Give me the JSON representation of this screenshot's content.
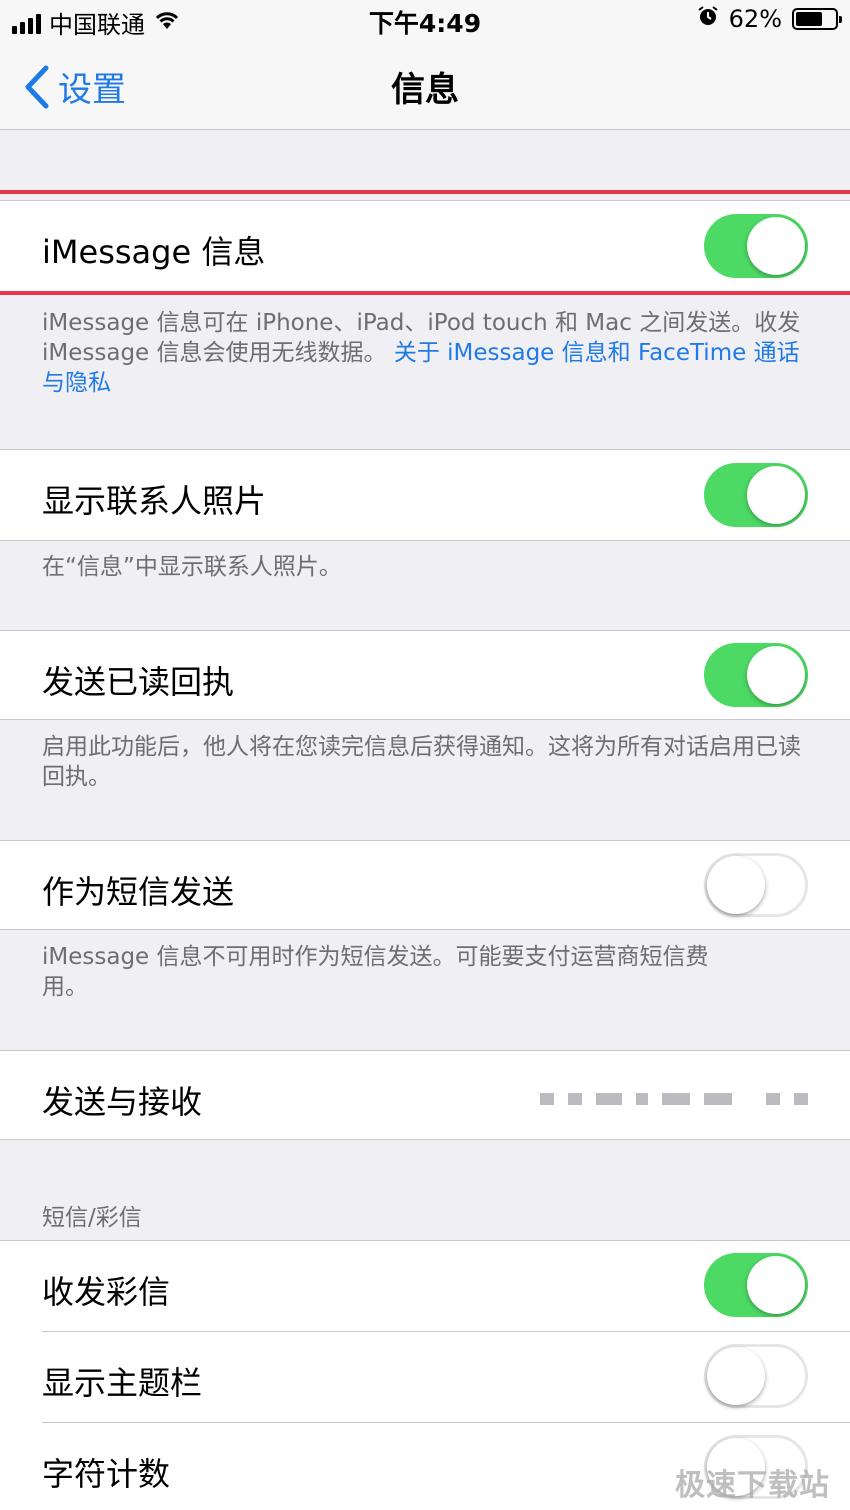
{
  "status_bar": {
    "carrier": "中国联通",
    "time": "下午4:49",
    "battery_percent": "62%",
    "battery_level": 0.62,
    "icons": [
      "signal-icon",
      "wifi-icon",
      "alarm-icon",
      "battery-icon"
    ]
  },
  "nav": {
    "back_label": "设置",
    "title": "信息"
  },
  "rows": {
    "imessage": {
      "label": "iMessage 信息",
      "on": true
    },
    "contact_photos": {
      "label": "显示联系人照片",
      "on": true
    },
    "read_receipts": {
      "label": "发送已读回执",
      "on": true
    },
    "send_as_sms": {
      "label": "作为短信发送",
      "on": false
    },
    "send_receive": {
      "label": "发送与接收"
    },
    "mms": {
      "label": "收发彩信",
      "on": true
    },
    "subject_field": {
      "label": "显示主题栏",
      "on": false
    },
    "char_count": {
      "label": "字符计数",
      "on": false
    }
  },
  "footers": {
    "imessage_text": "iMessage 信息可在 iPhone、iPad、iPod touch 和 Mac 之间发送。收发 iMessage 信息会使用无线数据。",
    "imessage_link": "关于 iMessage 信息和 FaceTime 通话与隐私",
    "contact_photos": "在“信息”中显示联系人照片。",
    "read_receipts": "启用此功能后，他人将在您读完信息后获得通知。这将为所有对话启用已读回执。",
    "send_as_sms": "iMessage 信息不可用时作为短信发送。可能要支付运营商短信费用。"
  },
  "section_headers": {
    "sms_mms": "短信/彩信"
  },
  "watermark": "极速下载站",
  "colors": {
    "accent_blue": "#1f7ae6",
    "toggle_green": "#4cd964",
    "highlight_red": "#e8364a",
    "grouped_background": "#efeff4"
  }
}
